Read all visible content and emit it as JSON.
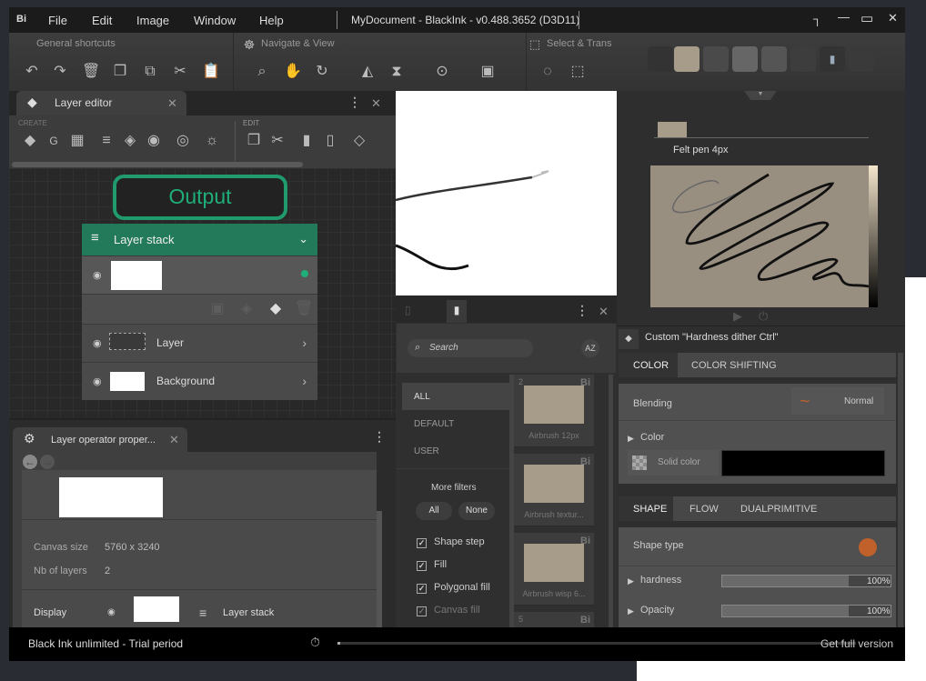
{
  "app": {
    "logo": "Bi",
    "title": "MyDocument - BlackInk  - v0.488.3652 (D3D11)"
  },
  "menu": [
    "File",
    "Edit",
    "Image",
    "Window",
    "Help"
  ],
  "toolbar": {
    "groups": [
      {
        "label": "General shortcuts",
        "icons": [
          "undo-icon",
          "redo-icon",
          "trash-icon",
          "copy-icon",
          "duplicate-icon",
          "scissors-icon",
          "clipboard-icon"
        ]
      },
      {
        "label": "Navigate & View",
        "icons": [
          "zoom-icon",
          "hand-icon",
          "rotate-hand-icon",
          "flip-horizontal-icon",
          "flip-vertical-icon",
          "zoom-fit-icon",
          "fullscreen-icon"
        ]
      },
      {
        "label": "Select & Trans",
        "icons": [
          "lasso-icon",
          "transform-icon"
        ]
      }
    ]
  },
  "layer_editor": {
    "tab": "Layer editor",
    "create_label": "CREATE",
    "edit_label": "EDIT",
    "output": "Output",
    "stack": {
      "title": "Layer stack",
      "layers": [
        {
          "name": "",
          "active": true
        },
        {
          "name": "Layer"
        },
        {
          "name": "Background"
        }
      ]
    }
  },
  "operator_props": {
    "tab": "Layer operator proper...",
    "canvas_size_label": "Canvas size",
    "canvas_size": "5760 x 3240",
    "nb_layers_label": "Nb of layers",
    "nb_layers": "2",
    "display_label": "Display",
    "display_target": "Layer stack"
  },
  "library": {
    "search_placeholder": "Search",
    "sort_label": "AZ",
    "categories": [
      "ALL",
      "DEFAULT",
      "USER"
    ],
    "selected_category": "ALL",
    "more_filters": "More filters",
    "all_btn": "All",
    "none_btn": "None",
    "filters": [
      {
        "label": "Shape step",
        "checked": true
      },
      {
        "label": "Fill",
        "checked": true
      },
      {
        "label": "Polygonal fill",
        "checked": true
      },
      {
        "label": "Canvas fill",
        "checked": true
      }
    ],
    "brushes": [
      {
        "badge": "2",
        "name": "Airbrush 12px"
      },
      {
        "badge": "",
        "name": "Airbrush textur..."
      },
      {
        "badge": "",
        "name": "Airbrush wisp 6..."
      },
      {
        "badge": "5",
        "name": ""
      }
    ]
  },
  "brush": {
    "name": "Felt pen 4px",
    "preset": "Custom \"Hardness dither Ctrl\"",
    "color_tabs": [
      "COLOR",
      "COLOR SHIFTING"
    ],
    "blending_label": "Blending",
    "blending_value": "Normal",
    "color_label": "Color",
    "solid_color_label": "Solid color",
    "solid_color": "#000000",
    "shape_tabs": [
      "SHAPE",
      "FLOW",
      "DUALPRIMITIVE"
    ],
    "shape_type_label": "Shape type",
    "params": [
      {
        "label": "hardness",
        "value": "100%",
        "fraction": 1.0
      },
      {
        "label": "Opacity",
        "value": "100%",
        "fraction": 1.0
      }
    ]
  },
  "status": {
    "text": "Black Ink unlimited - Trial period",
    "cta": "Get full version"
  },
  "colors": {
    "accent": "#1f9b6d",
    "node_header": "#237a5a",
    "shape_dot": "#c0612b"
  }
}
